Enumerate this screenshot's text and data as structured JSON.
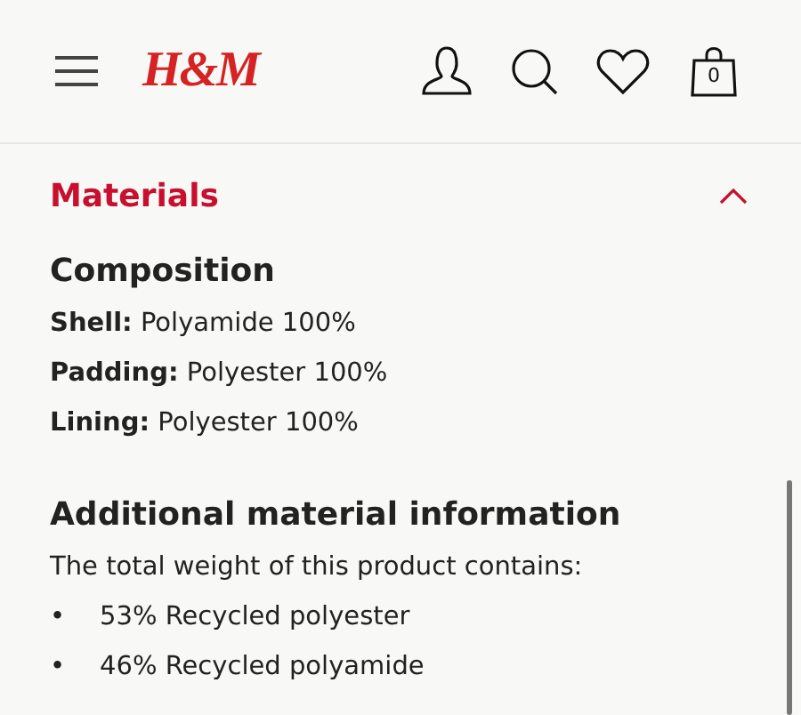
{
  "header": {
    "logo": "H&M",
    "bag_count": "0"
  },
  "section": {
    "title": "Materials",
    "expanded": true
  },
  "composition": {
    "heading": "Composition",
    "rows": [
      {
        "label": "Shell:",
        "value": "Polyamide 100%"
      },
      {
        "label": "Padding:",
        "value": "Polyester 100%"
      },
      {
        "label": "Lining:",
        "value": "Polyester 100%"
      }
    ]
  },
  "additional": {
    "heading": "Additional material information",
    "intro": "The total weight of this product contains:",
    "bullets": [
      {
        "marker": "•",
        "text": "53% Recycled polyester"
      },
      {
        "marker": "•",
        "text": "46% Recycled polyamide"
      }
    ]
  }
}
